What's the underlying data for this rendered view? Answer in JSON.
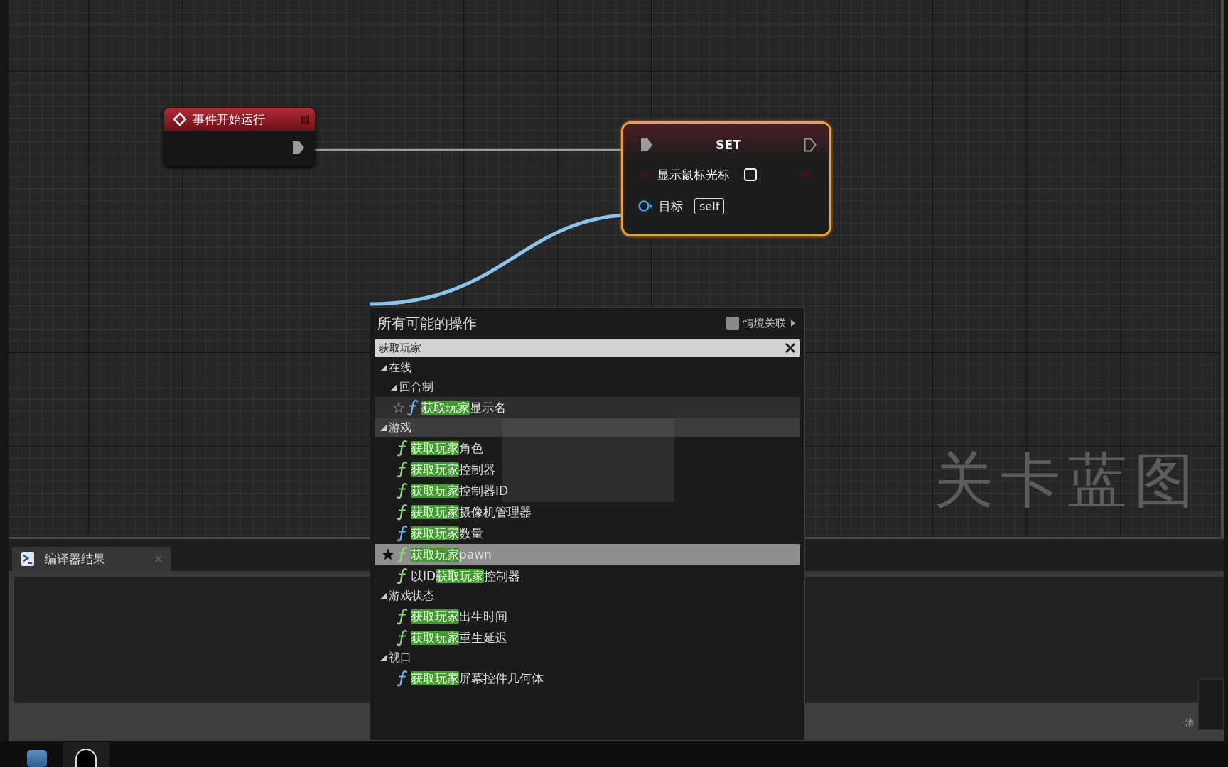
{
  "graph": {
    "nodes": [
      {
        "kind": "event",
        "title": "事件开始运行"
      },
      {
        "kind": "set",
        "title": "SET",
        "selected": true,
        "pins": [
          {
            "kind": "bool",
            "label": "显示鼠标光标",
            "checked": false
          },
          {
            "kind": "object",
            "label": "目标",
            "value": "self",
            "connected": true
          }
        ]
      }
    ],
    "watermark": "关卡蓝图"
  },
  "menu": {
    "title": "所有可能的操作",
    "context_toggle": {
      "label": "情境关联",
      "checked": false
    },
    "search": {
      "value": "获取玩家"
    },
    "tree": [
      {
        "label": "在线",
        "expanded": true,
        "highlighted": false,
        "children": [
          {
            "label": "回合制",
            "expanded": true,
            "highlighted": false,
            "children": [
              {
                "kind": "function",
                "match": "获取玩家",
                "suffix": "显示名",
                "hovered": true,
                "selected": false,
                "favorite": false
              }
            ]
          }
        ]
      },
      {
        "label": "游戏",
        "expanded": true,
        "highlighted": true,
        "children": [
          {
            "kind": "pure_function",
            "match": "获取玩家",
            "suffix": "角色",
            "hovered": false,
            "selected": false
          },
          {
            "kind": "pure_function",
            "match": "获取玩家",
            "suffix": "控制器",
            "hovered": false,
            "selected": false
          },
          {
            "kind": "pure_function",
            "match": "获取玩家",
            "suffix": "控制器ID",
            "hovered": false,
            "selected": false
          },
          {
            "kind": "pure_function",
            "match": "获取玩家",
            "suffix": "摄像机管理器",
            "hovered": false,
            "selected": false
          },
          {
            "kind": "function",
            "match": "获取玩家",
            "suffix": "数量",
            "hovered": false,
            "selected": false
          },
          {
            "kind": "pure_function",
            "match": "获取玩家",
            "suffix": "pawn",
            "hovered": false,
            "selected": true,
            "favorite": true
          },
          {
            "kind": "pure_function",
            "prefix": "以ID",
            "match": "获取玩家",
            "suffix": "控制器",
            "hovered": false,
            "selected": false
          }
        ]
      },
      {
        "label": "游戏状态",
        "expanded": true,
        "highlighted": false,
        "children": [
          {
            "kind": "pure_function",
            "match": "获取玩家",
            "suffix": "出生时间",
            "hovered": false,
            "selected": false
          },
          {
            "kind": "pure_function",
            "match": "获取玩家",
            "suffix": "重生延迟",
            "hovered": false,
            "selected": false
          }
        ]
      },
      {
        "label": "视口",
        "expanded": true,
        "highlighted": false,
        "children": [
          {
            "kind": "function",
            "match": "获取玩家",
            "suffix": "屏幕控件几何体",
            "hovered": false,
            "selected": false
          }
        ]
      }
    ]
  },
  "bottom_panel": {
    "tabs": [
      {
        "label": "编译器结果",
        "selected": true
      }
    ],
    "footer_text": "清"
  }
}
